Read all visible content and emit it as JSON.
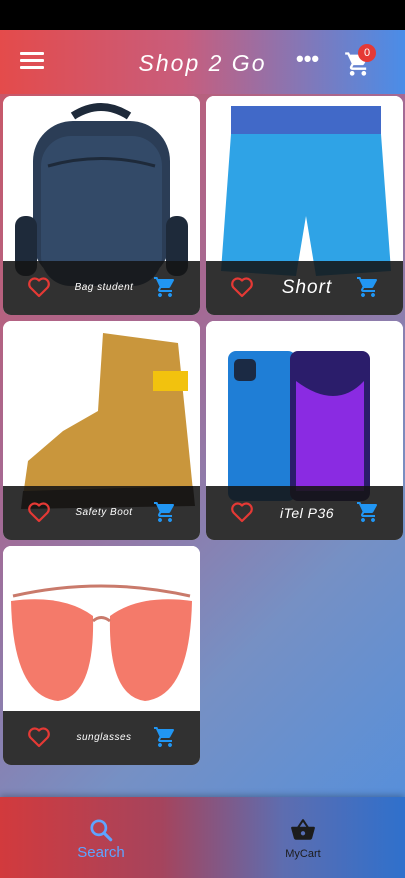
{
  "appbar": {
    "title": "Shop 2 Go",
    "cart_count": "0"
  },
  "products": [
    {
      "name": "Bag student",
      "image": "backpack-image"
    },
    {
      "name": "Short",
      "image": "shorts-image"
    },
    {
      "name": "Safety Boot",
      "image": "boot-image"
    },
    {
      "name": "iTel P36",
      "image": "phone-image"
    },
    {
      "name": "sunglasses",
      "image": "sunglasses-image"
    }
  ],
  "bottom_nav": {
    "search_label": "Search",
    "mycart_label": "MyCart"
  },
  "colors": {
    "heart": "#e53935",
    "cart_icon": "#2196f3",
    "active_nav": "#5ea4ff",
    "badge": "#e53935"
  }
}
